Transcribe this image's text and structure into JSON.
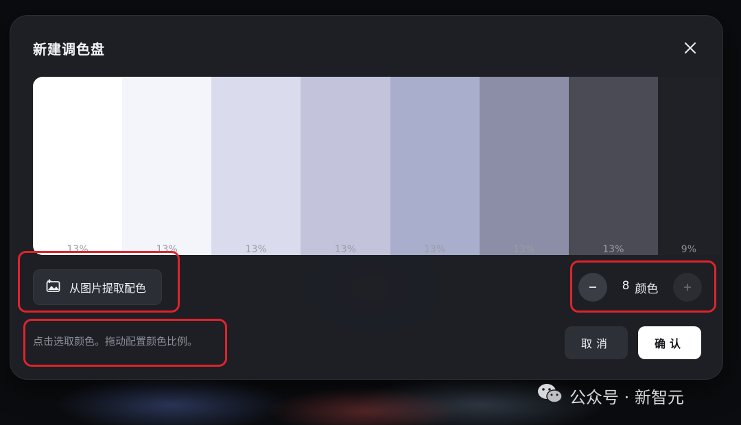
{
  "dialog": {
    "title": "新建调色盘",
    "close_icon": "close-icon"
  },
  "palette": {
    "swatches": [
      {
        "color": "#ffffff",
        "percent": "13%",
        "share": 13
      },
      {
        "color": "#f4f5fb",
        "percent": "13%",
        "share": 13
      },
      {
        "color": "#dadced",
        "percent": "13%",
        "share": 13
      },
      {
        "color": "#c3c4dc",
        "percent": "13%",
        "share": 13
      },
      {
        "color": "#a8aecb",
        "percent": "13%",
        "share": 13
      },
      {
        "color": "#8b8ea6",
        "percent": "13%",
        "share": 13
      },
      {
        "color": "#4a4b55",
        "percent": "13%",
        "share": 13
      },
      {
        "color": "#1f2126",
        "percent": "9%",
        "share": 9
      }
    ]
  },
  "extract_button": {
    "label": "从图片提取配色",
    "icon": "image-add-icon"
  },
  "stepper": {
    "count": "8",
    "unit": "颜色",
    "minus_icon": "minus-icon",
    "plus_icon": "plus-icon"
  },
  "hint": "点击选取颜色。拖动配置颜色比例。",
  "actions": {
    "cancel_label": "取消",
    "confirm_label": "确认"
  },
  "watermark": {
    "text": "公众号 · 新智元",
    "icon": "wechat-icon"
  },
  "colors": {
    "highlight_box": "#e0242c",
    "dialog_bg": "#1e2026"
  }
}
